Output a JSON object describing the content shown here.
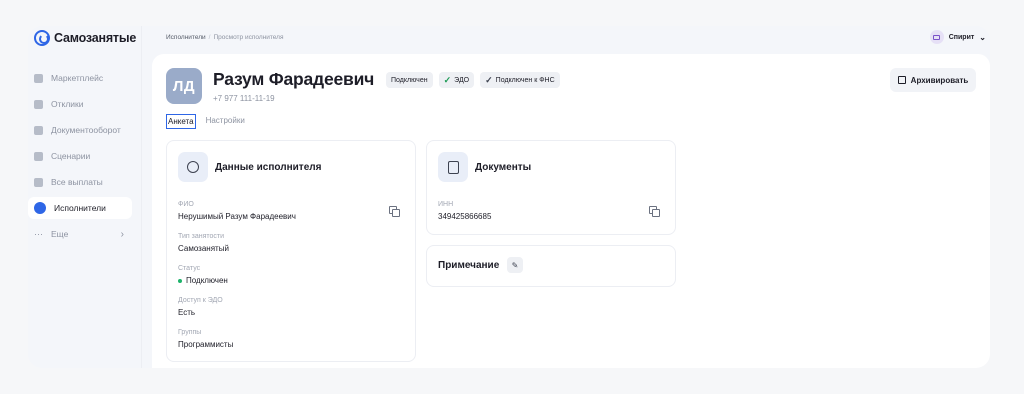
{
  "app": {
    "name": "Самозанятые"
  },
  "sidebar": {
    "items": [
      {
        "label": "Маркетплейс",
        "active": false
      },
      {
        "label": "Отклики",
        "active": false
      },
      {
        "label": "Документооборот",
        "active": false
      },
      {
        "label": "Сценарии",
        "active": false
      },
      {
        "label": "Все выплаты",
        "active": false
      },
      {
        "label": "Исполнители",
        "active": true
      },
      {
        "label": "Еще",
        "active": false
      }
    ]
  },
  "breadcrumb": {
    "parent": "Исполнители",
    "separator": "/",
    "current": "Просмотр исполнителя"
  },
  "user": {
    "name": "Спирит"
  },
  "profile": {
    "initials": "ЛД",
    "name": "Разум Фарадеевич",
    "phone": "+7 977 111-11-19",
    "badges": [
      {
        "label": "Подключен",
        "check": false
      },
      {
        "label": "ЭДО",
        "check": true
      },
      {
        "label": "Подключен к ФНС",
        "check": true
      }
    ],
    "archive_label": "Архивировать"
  },
  "tabs": [
    {
      "label": "Анкета",
      "active": true
    },
    {
      "label": "Настройки",
      "active": false
    }
  ],
  "executor_card": {
    "title": "Данные исполнителя",
    "fields": [
      {
        "label": "ФИО",
        "value": "Нерушимый Разум Фарадеевич"
      },
      {
        "label": "Тип занятости",
        "value": "Самозанятый"
      },
      {
        "label": "Статус",
        "value": "Подключен"
      },
      {
        "label": "Доступ к ЭДО",
        "value": "Есть"
      },
      {
        "label": "Группы",
        "value": "Программисты"
      }
    ]
  },
  "documents_card": {
    "title": "Документы",
    "fields": [
      {
        "label": "ИНН",
        "value": "349425866685"
      }
    ]
  },
  "note_card": {
    "title": "Примечание"
  },
  "colors": {
    "accent": "#2e66e6",
    "status_ok": "#1db36a",
    "avatar_bg": "#9aabc9"
  }
}
